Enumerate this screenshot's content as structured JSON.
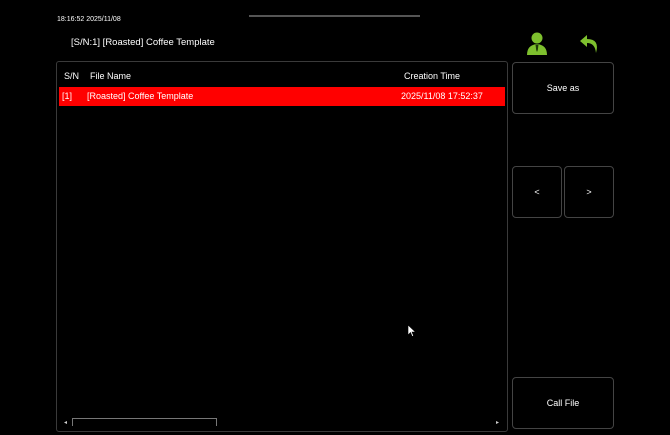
{
  "status": {
    "clock": "18:16:52 2025/11/08"
  },
  "header": {
    "title": "[S/N:1] [Roasted] Coffee Template"
  },
  "icons": {
    "user": "user-icon",
    "back": "back-arrow-icon",
    "cursor": "mouse-cursor"
  },
  "table": {
    "columns": {
      "sn": "S/N",
      "name": "File Name",
      "time": "Creation Time"
    },
    "rows": [
      {
        "sn": "[1]",
        "name": "[Roasted] Coffee Template",
        "time": "2025/11/08 17:52:37",
        "selected": true
      }
    ]
  },
  "scrollbar": {
    "left": "◂",
    "right": "▸"
  },
  "buttons": {
    "save_as": "Save as",
    "prev": "<",
    "next": ">",
    "call_file": "Call File"
  },
  "colors": {
    "selected_row": "#ff0000",
    "icon_green": "#7ec02e",
    "background": "#000000"
  }
}
